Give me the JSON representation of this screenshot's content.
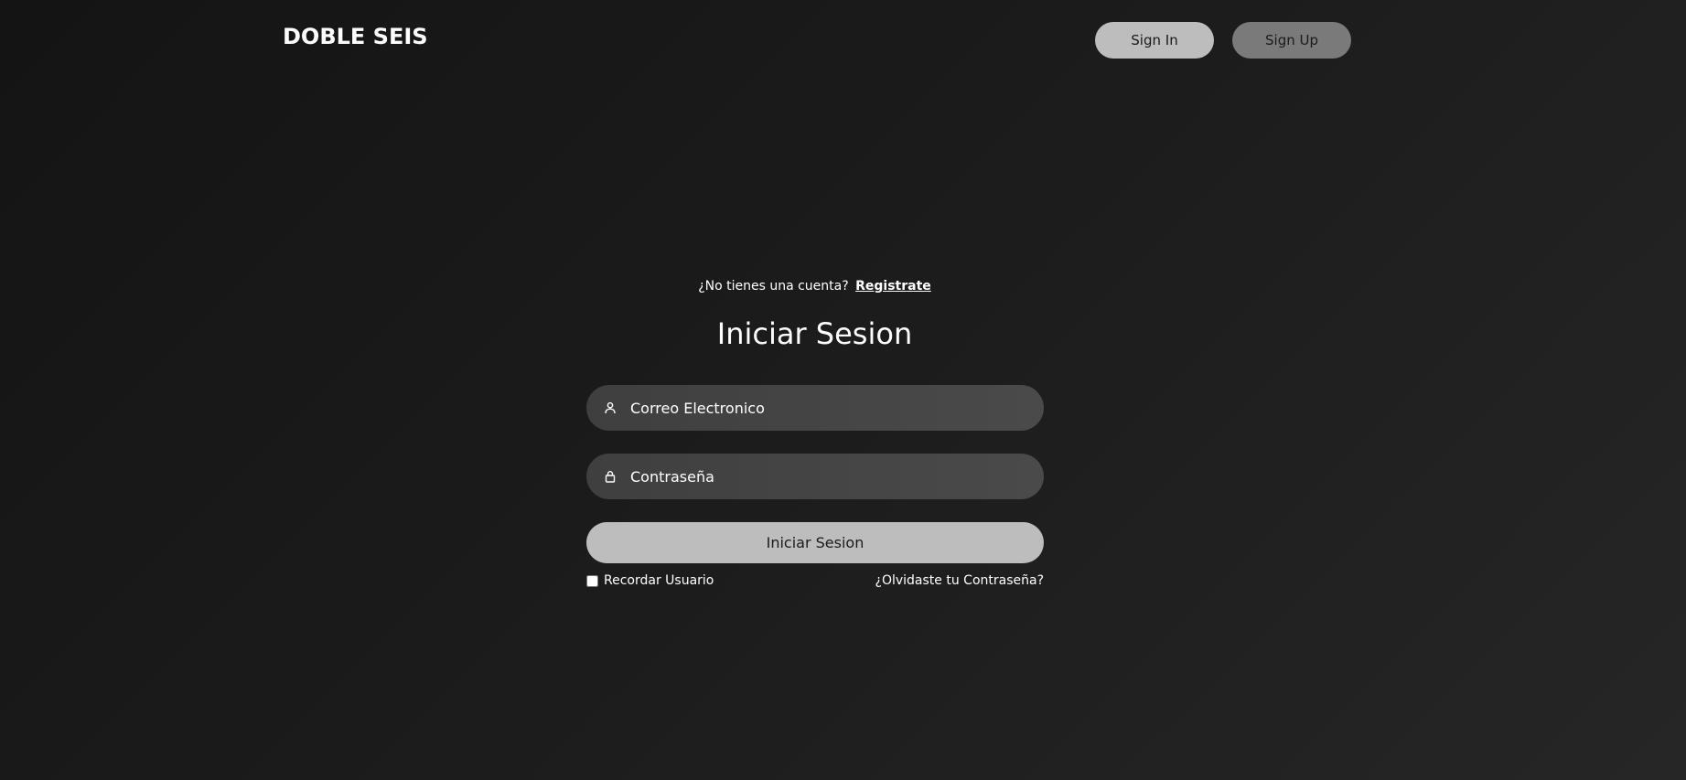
{
  "header": {
    "brand": "DOBLE SEIS",
    "sign_in_label": "Sign In",
    "sign_up_label": "Sign Up"
  },
  "login": {
    "no_account_text": "¿No tienes una cuenta?",
    "register_link": "Registrate",
    "title": "Iniciar Sesion",
    "email_placeholder": "Correo Electronico",
    "password_placeholder": "Contraseña",
    "submit_label": "Iniciar Sesion",
    "remember_label": "Recordar Usuario",
    "remember_checked": false,
    "forgot_link": "¿Olvidaste tu Contraseña?"
  },
  "colors": {
    "primary_button": "#bdbdbd",
    "secondary_button": "#7a7a7a",
    "field_background": "#444444",
    "background": "#1c1c1c"
  },
  "icons": {
    "email_field_icon": "user-icon",
    "password_field_icon": "lock-icon"
  }
}
